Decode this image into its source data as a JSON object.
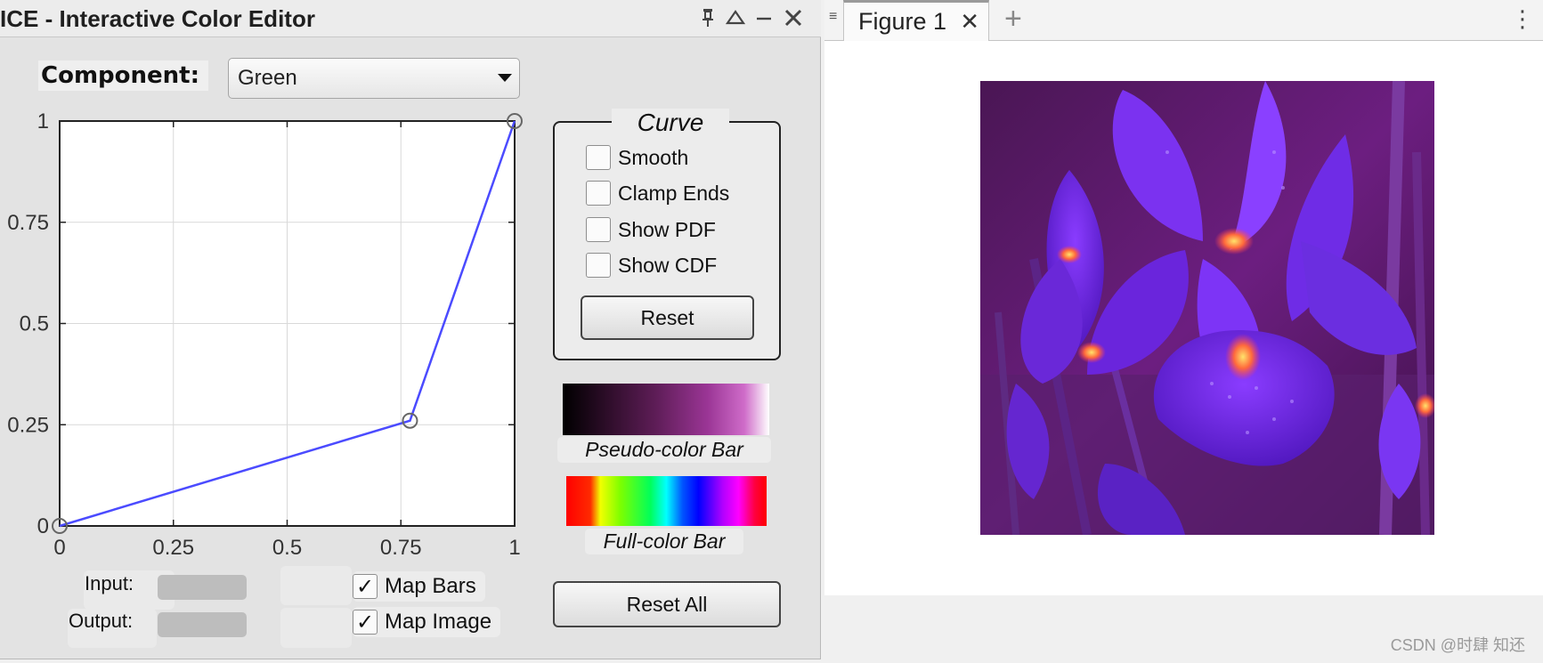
{
  "ice": {
    "title": "ICE - Interactive Color Editor",
    "titlebar_controls": [
      "pin-icon",
      "maximize-icon",
      "minimize-icon",
      "close-icon"
    ],
    "component_label": "Component:",
    "component_value": "Green",
    "plot": {
      "x_ticks": [
        "0",
        "0.25",
        "0.5",
        "0.75",
        "1"
      ],
      "y_ticks": [
        "0",
        "0.25",
        "0.5",
        "0.75",
        "1"
      ],
      "curve_points": [
        [
          0,
          0
        ],
        [
          0.77,
          0.26
        ],
        [
          1,
          1
        ]
      ],
      "curve_color": "#4b4bff",
      "grid": true,
      "xlim": [
        0,
        1
      ],
      "ylim": [
        0,
        1
      ]
    },
    "curve_panel": {
      "legend": "Curve",
      "options": [
        {
          "label": "Smooth",
          "checked": false
        },
        {
          "label": "Clamp Ends",
          "checked": false
        },
        {
          "label": "Show PDF",
          "checked": false
        },
        {
          "label": "Show CDF",
          "checked": false
        }
      ],
      "reset_label": "Reset"
    },
    "pseudo_bar_label": "Pseudo-color Bar",
    "full_bar_label": "Full-color Bar",
    "input_label": "Input:",
    "output_label": "Output:",
    "map_bars": {
      "label": "Map Bars",
      "checked": true
    },
    "map_image": {
      "label": "Map Image",
      "checked": true
    },
    "reset_all_label": "Reset All"
  },
  "figure": {
    "tab_label": "Figure 1",
    "image_icon": "purple-iris-photo-image",
    "watermark": "CSDN @时肆 知还"
  }
}
